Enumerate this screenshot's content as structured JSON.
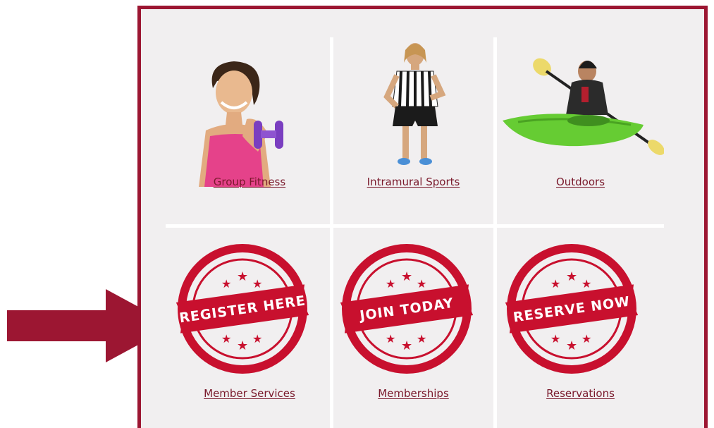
{
  "tiles": [
    {
      "link_label": "Group Fitness",
      "art": "woman-with-dumbbell-photo"
    },
    {
      "link_label": "Intramural Sports",
      "art": "referee-photo"
    },
    {
      "link_label": "Outdoors",
      "art": "man-in-kayak-photo"
    },
    {
      "link_label": "Member Services",
      "art": "register-stamp",
      "stamp_text": "REGISTER HERE"
    },
    {
      "link_label": "Memberships",
      "art": "join-stamp",
      "stamp_text": "JOIN TODAY"
    },
    {
      "link_label": "Reservations",
      "art": "reserve-stamp",
      "stamp_text": "RESERVE NOW"
    }
  ],
  "colors": {
    "brand": "#9c1632",
    "panel_background": "#f1eff0",
    "link": "#7a1a2c",
    "stamp_red": "#c8102e"
  },
  "annotation": {
    "icon": "arrow-right-icon",
    "points_to": "Member Services"
  }
}
